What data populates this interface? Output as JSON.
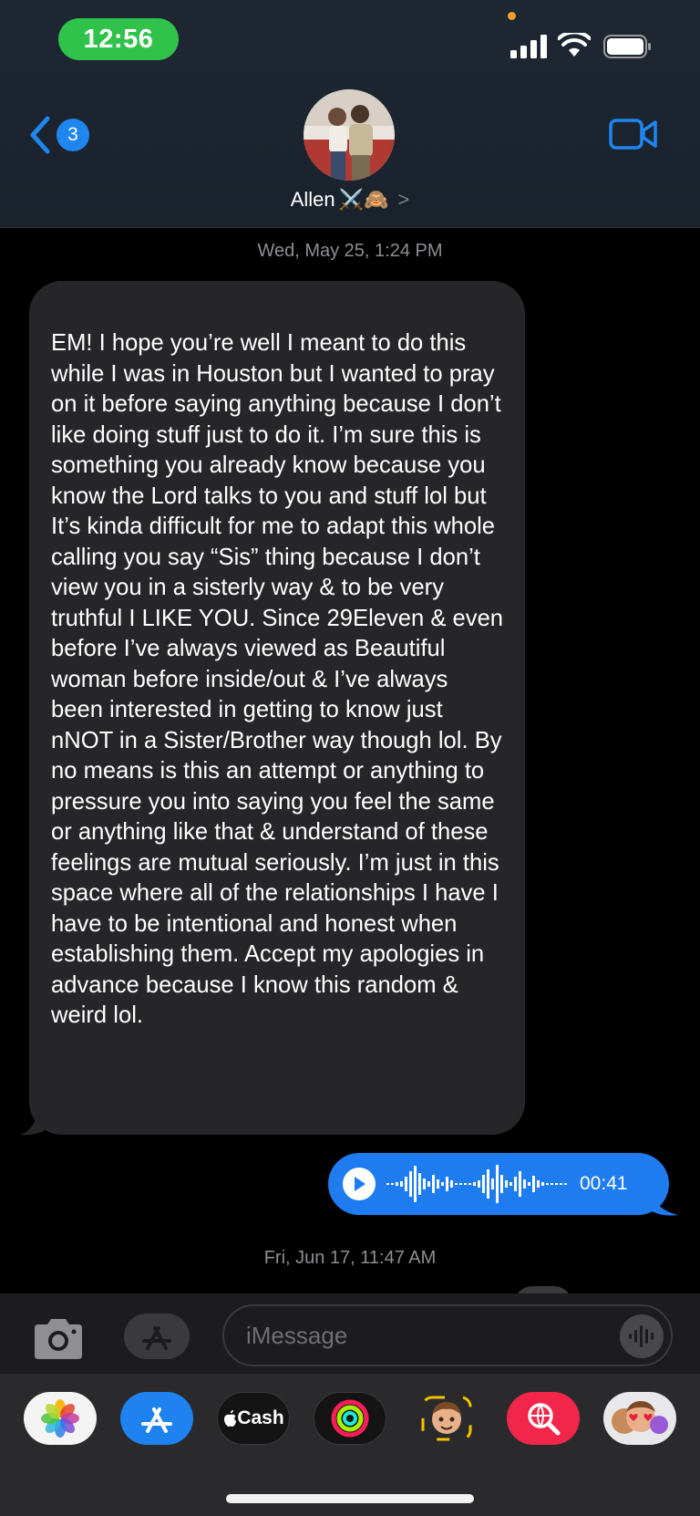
{
  "status_bar": {
    "time": "12:56"
  },
  "header": {
    "back_badge_count": "3",
    "contact_name": "Allen",
    "contact_emojis": "⚔️🙈",
    "chevron": ">"
  },
  "conversation": {
    "timestamp_1": "Wed, May 25, 1:24 PM",
    "incoming_message": "EM! I hope you’re well I meant to do this while I was in Houston but I wanted to pray on it before saying anything because I don’t like doing stuff just to do it. I’m sure this is something you already know because you know the Lord talks to you and stuff lol but It’s kinda difficult for me to adapt this whole calling you say “Sis” thing because I don’t view you in a sisterly way & to be very truthful I LIKE YOU. Since 29Eleven & even before I’ve always viewed as Beautiful woman before inside/out & I’ve always been interested in getting to know just nNOT in a Sister/Brother way though lol. By no means is this an attempt or anything to pressure you into saying you feel the same or anything like that & understand of these feelings are mutual seriously. I’m just in this space where all of the relationships I have I have to be intentional and honest when establishing them. Accept my apologies in advance because I know this random & weird lol.",
    "audio_duration": "00:41",
    "timestamp_2": "Fri, Jun 17, 11:47 AM"
  },
  "composer": {
    "placeholder": "iMessage"
  },
  "app_tray": {
    "cash_label": "Cash",
    "apps": [
      "photos-app",
      "app-store-app",
      "apple-cash-app",
      "activity-app",
      "memoji-app",
      "web-search-app",
      "memoji-stickers-app"
    ]
  },
  "colors": {
    "accent_blue": "#1e7cf0",
    "status_green": "#30c24a",
    "incoming_bubble": "#262628"
  }
}
